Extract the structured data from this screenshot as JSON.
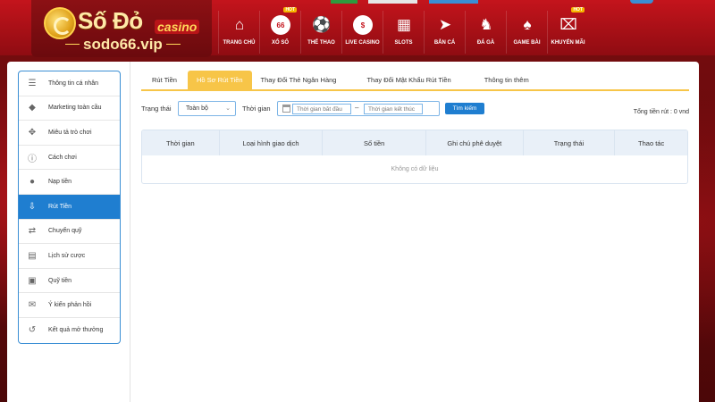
{
  "header": {
    "logo": {
      "title": "Số Đỏ",
      "badge": "casino",
      "subtitle": "sodo66.vip"
    },
    "nav": [
      {
        "label": "TRANG CHỦ",
        "icon": "home-icon",
        "glyph": "⌂",
        "hot": ""
      },
      {
        "label": "XỔ SỐ",
        "icon": "lottery-ball-icon",
        "glyph": "66",
        "hot": "HOT"
      },
      {
        "label": "THỂ THAO",
        "icon": "soccer-ball-icon",
        "glyph": "⚽",
        "hot": ""
      },
      {
        "label": "LIVE CASINO",
        "icon": "casino-chip-icon",
        "glyph": "$",
        "hot": ""
      },
      {
        "label": "SLOTS",
        "icon": "slot-machine-icon",
        "glyph": "▦",
        "hot": ""
      },
      {
        "label": "BẮN CÁ",
        "icon": "fish-icon",
        "glyph": "➤",
        "hot": ""
      },
      {
        "label": "ĐÁ GÀ",
        "icon": "rooster-icon",
        "glyph": "♞",
        "hot": ""
      },
      {
        "label": "GAME BÀI",
        "icon": "playing-cards-icon",
        "glyph": "♠",
        "hot": ""
      },
      {
        "label": "KHUYẾN MÃI",
        "icon": "gift-icon",
        "glyph": "⌧",
        "hot": "HOT"
      }
    ]
  },
  "sidebar": {
    "items": [
      {
        "label": "Thông tin cá nhân",
        "icon": "user-card-icon",
        "glyph": "☰",
        "active": false
      },
      {
        "label": "Marketing toàn cầu",
        "icon": "diamond-icon",
        "glyph": "◆",
        "active": false
      },
      {
        "label": "Miêu tả trò chơi",
        "icon": "gamepad-icon",
        "glyph": "✥",
        "active": false
      },
      {
        "label": "Cách chơi",
        "icon": "info-icon",
        "glyph": "ⓘ",
        "active": false
      },
      {
        "label": "Nạp tiền",
        "icon": "piggy-bank-icon",
        "glyph": "●",
        "active": false
      },
      {
        "label": "Rút Tiền",
        "icon": "withdraw-icon",
        "glyph": "⇩",
        "active": true
      },
      {
        "label": "Chuyển quỹ",
        "icon": "transfer-icon",
        "glyph": "⇄",
        "active": false
      },
      {
        "label": "Lịch sử cược",
        "icon": "history-list-icon",
        "glyph": "▤",
        "active": false
      },
      {
        "label": "Quỹ tiền",
        "icon": "fund-icon",
        "glyph": "▣",
        "active": false
      },
      {
        "label": "Ý kiến phản hồi",
        "icon": "chat-bubble-icon",
        "glyph": "✉",
        "active": false
      },
      {
        "label": "Kết quả mở thưởng",
        "icon": "clock-history-icon",
        "glyph": "↺",
        "active": false
      }
    ]
  },
  "tabs": [
    {
      "label": "Rút Tiền",
      "active": false
    },
    {
      "label": "Hồ Sơ Rút Tiền",
      "active": true
    },
    {
      "label": "Thay Đổi Thẻ Ngân Hàng",
      "active": false
    },
    {
      "label": "Thay Đổi Mật Khẩu Rút Tiền",
      "active": false
    },
    {
      "label": "Thông tin thêm",
      "active": false
    }
  ],
  "filter": {
    "status_label": "Trạng thái",
    "status_value": "Toàn bộ",
    "time_label": "Thời gian",
    "start_placeholder": "Thời gian bắt đầu",
    "end_placeholder": "Thời gian kết thúc",
    "separator": "–",
    "search_button": "Tìm kiếm",
    "total": "Tổng tiền rút : 0 vnd"
  },
  "table": {
    "columns": [
      "Thời gian",
      "Loại hình giao dịch",
      "Số tiền",
      "Ghi chú phê duyệt",
      "Trạng thái",
      "Thao tác"
    ],
    "empty": "Không có dữ liệu"
  },
  "colors": {
    "header_red": "#c4141c",
    "accent_blue": "#1f7ed0",
    "tab_yellow": "#f7c548"
  }
}
